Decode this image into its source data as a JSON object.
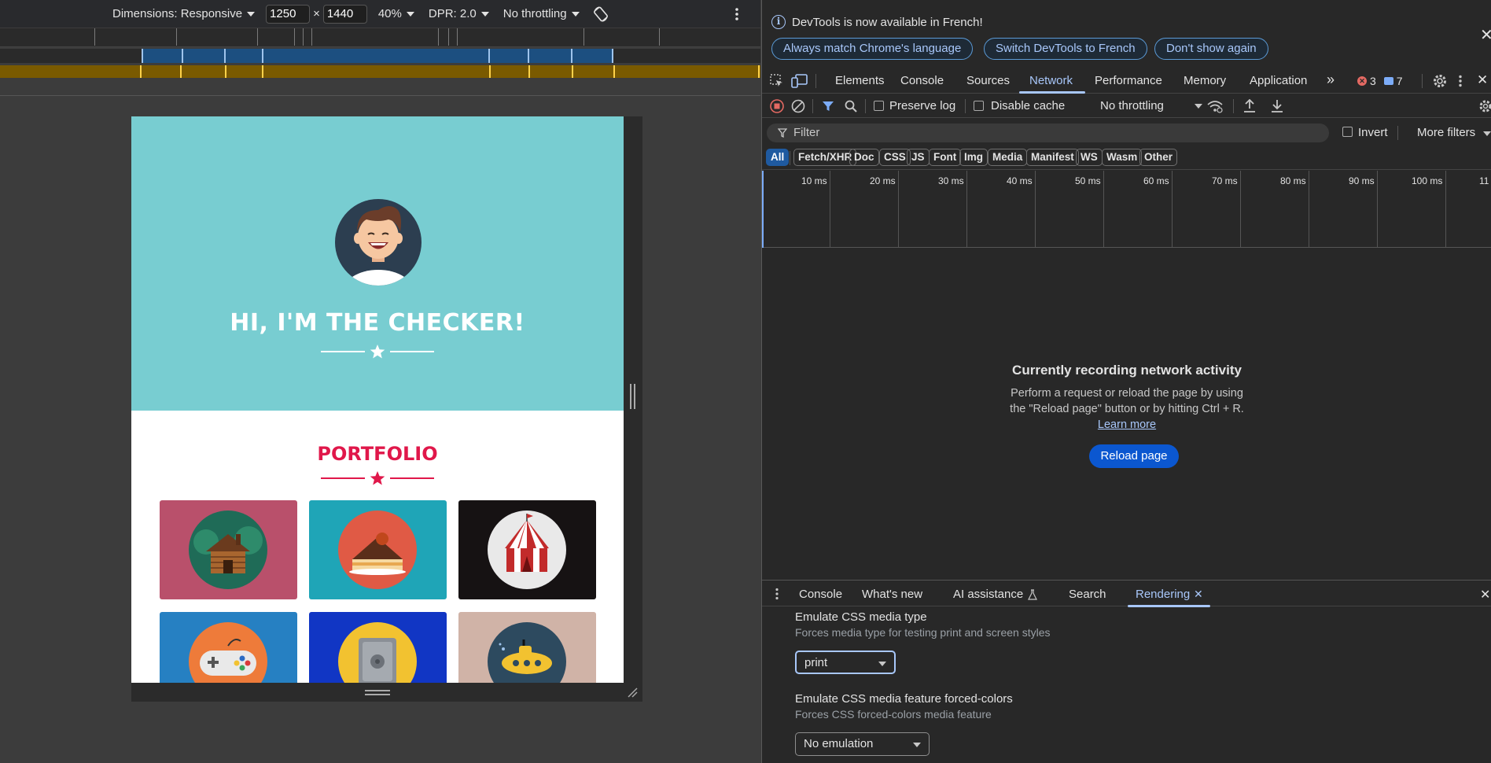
{
  "device_toolbar": {
    "dimensions_label": "Dimensions: Responsive",
    "width_value": "1250",
    "times": "×",
    "height_value": "1440",
    "zoom": "40%",
    "dpr": "DPR: 2.0",
    "throttling": "No throttling"
  },
  "page": {
    "hero_title": "HI, I'M THE CHECKER!",
    "portfolio_title": "PORTFOLIO",
    "colors": {
      "hero_bg": "#78cdd1",
      "accent": "#e0174a"
    },
    "tiles": [
      {
        "icon": "cabin-icon",
        "bg": "#b9506b"
      },
      {
        "icon": "cake-slice-icon",
        "bg": "#1fa5b7"
      },
      {
        "icon": "circus-tent-icon",
        "bg": "#161213"
      },
      {
        "icon": "game-controller-icon",
        "bg": "#2680c2"
      },
      {
        "icon": "safe-icon",
        "bg": "#1136c4"
      },
      {
        "icon": "submarine-icon",
        "bg": "#d0b3a7"
      }
    ]
  },
  "devtools": {
    "infobar": {
      "message": "DevTools is now available in French!",
      "buttons": [
        "Always match Chrome's language",
        "Switch DevTools to French",
        "Don't show again"
      ]
    },
    "tabs": [
      "Elements",
      "Console",
      "Sources",
      "Network",
      "Performance",
      "Memory",
      "Application"
    ],
    "active_tab": "Network",
    "error_count": "3",
    "message_count": "7",
    "network_toolbar": {
      "preserve_log": "Preserve log",
      "disable_cache": "Disable cache",
      "throttling": "No throttling"
    },
    "filter": {
      "placeholder": "Filter",
      "invert": "Invert",
      "more_filters": "More filters"
    },
    "type_filters": [
      "All",
      "Fetch/XHR",
      "Doc",
      "CSS",
      "JS",
      "Font",
      "Img",
      "Media",
      "Manifest",
      "WS",
      "Wasm",
      "Other"
    ],
    "active_type": "All",
    "timeline_labels": [
      "10 ms",
      "20 ms",
      "30 ms",
      "40 ms",
      "50 ms",
      "60 ms",
      "70 ms",
      "80 ms",
      "90 ms",
      "100 ms",
      "11"
    ],
    "empty_state": {
      "title": "Currently recording network activity",
      "text": "Perform a request or reload the page by using the \"Reload page\" button or by hitting Ctrl + R.",
      "link": "Learn more",
      "button": "Reload page"
    },
    "drawer_tabs": [
      "Console",
      "What's new",
      "AI assistance",
      "Search",
      "Rendering"
    ],
    "active_drawer_tab": "Rendering",
    "rendering": {
      "media_type_title": "Emulate CSS media type",
      "media_type_desc": "Forces media type for testing print and screen styles",
      "media_type_value": "print",
      "forced_colors_title": "Emulate CSS media feature forced-colors",
      "forced_colors_desc": "Forces CSS forced-colors media feature",
      "forced_colors_value": "No emulation"
    }
  }
}
